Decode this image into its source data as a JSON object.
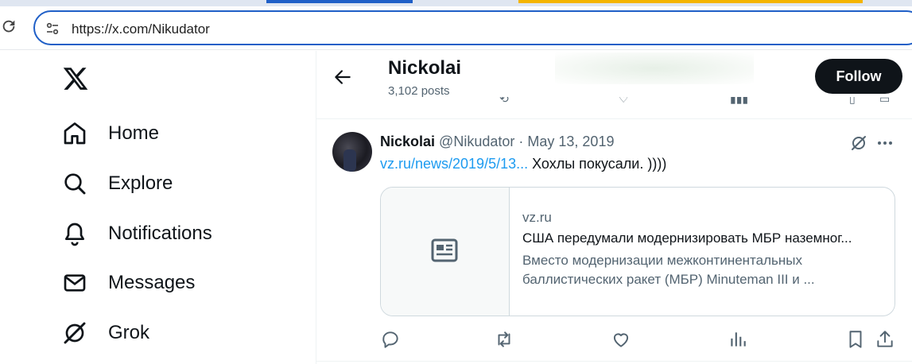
{
  "browser": {
    "url": "https://x.com/Nikudator",
    "accent_blue": "#1f5fc7",
    "accent_orange": "#f4b400"
  },
  "nav": {
    "items": [
      {
        "label": "Home",
        "icon": "home-icon"
      },
      {
        "label": "Explore",
        "icon": "search-icon"
      },
      {
        "label": "Notifications",
        "icon": "bell-icon"
      },
      {
        "label": "Messages",
        "icon": "mail-icon"
      },
      {
        "label": "Grok",
        "icon": "grok-icon"
      }
    ]
  },
  "header": {
    "name": "Nickolai",
    "post_count": "3,102 posts",
    "follow_label": "Follow"
  },
  "tweet": {
    "name": "Nickolai",
    "handle": "@Nikudator",
    "separator": "·",
    "date": "May 13, 2019",
    "link_text": "vz.ru/news/2019/5/13...",
    "body_text": " Хохлы покусали. ))))",
    "card": {
      "domain": "vz.ru",
      "title": "США передумали модернизировать МБР наземног...",
      "description": "Вместо модернизации межконтинентальных баллистических ракет (МБР) Minuteman III и ..."
    }
  },
  "colors": {
    "link": "#1d9bf0",
    "secondary_text": "#536471",
    "primary_text": "#0f1419"
  }
}
